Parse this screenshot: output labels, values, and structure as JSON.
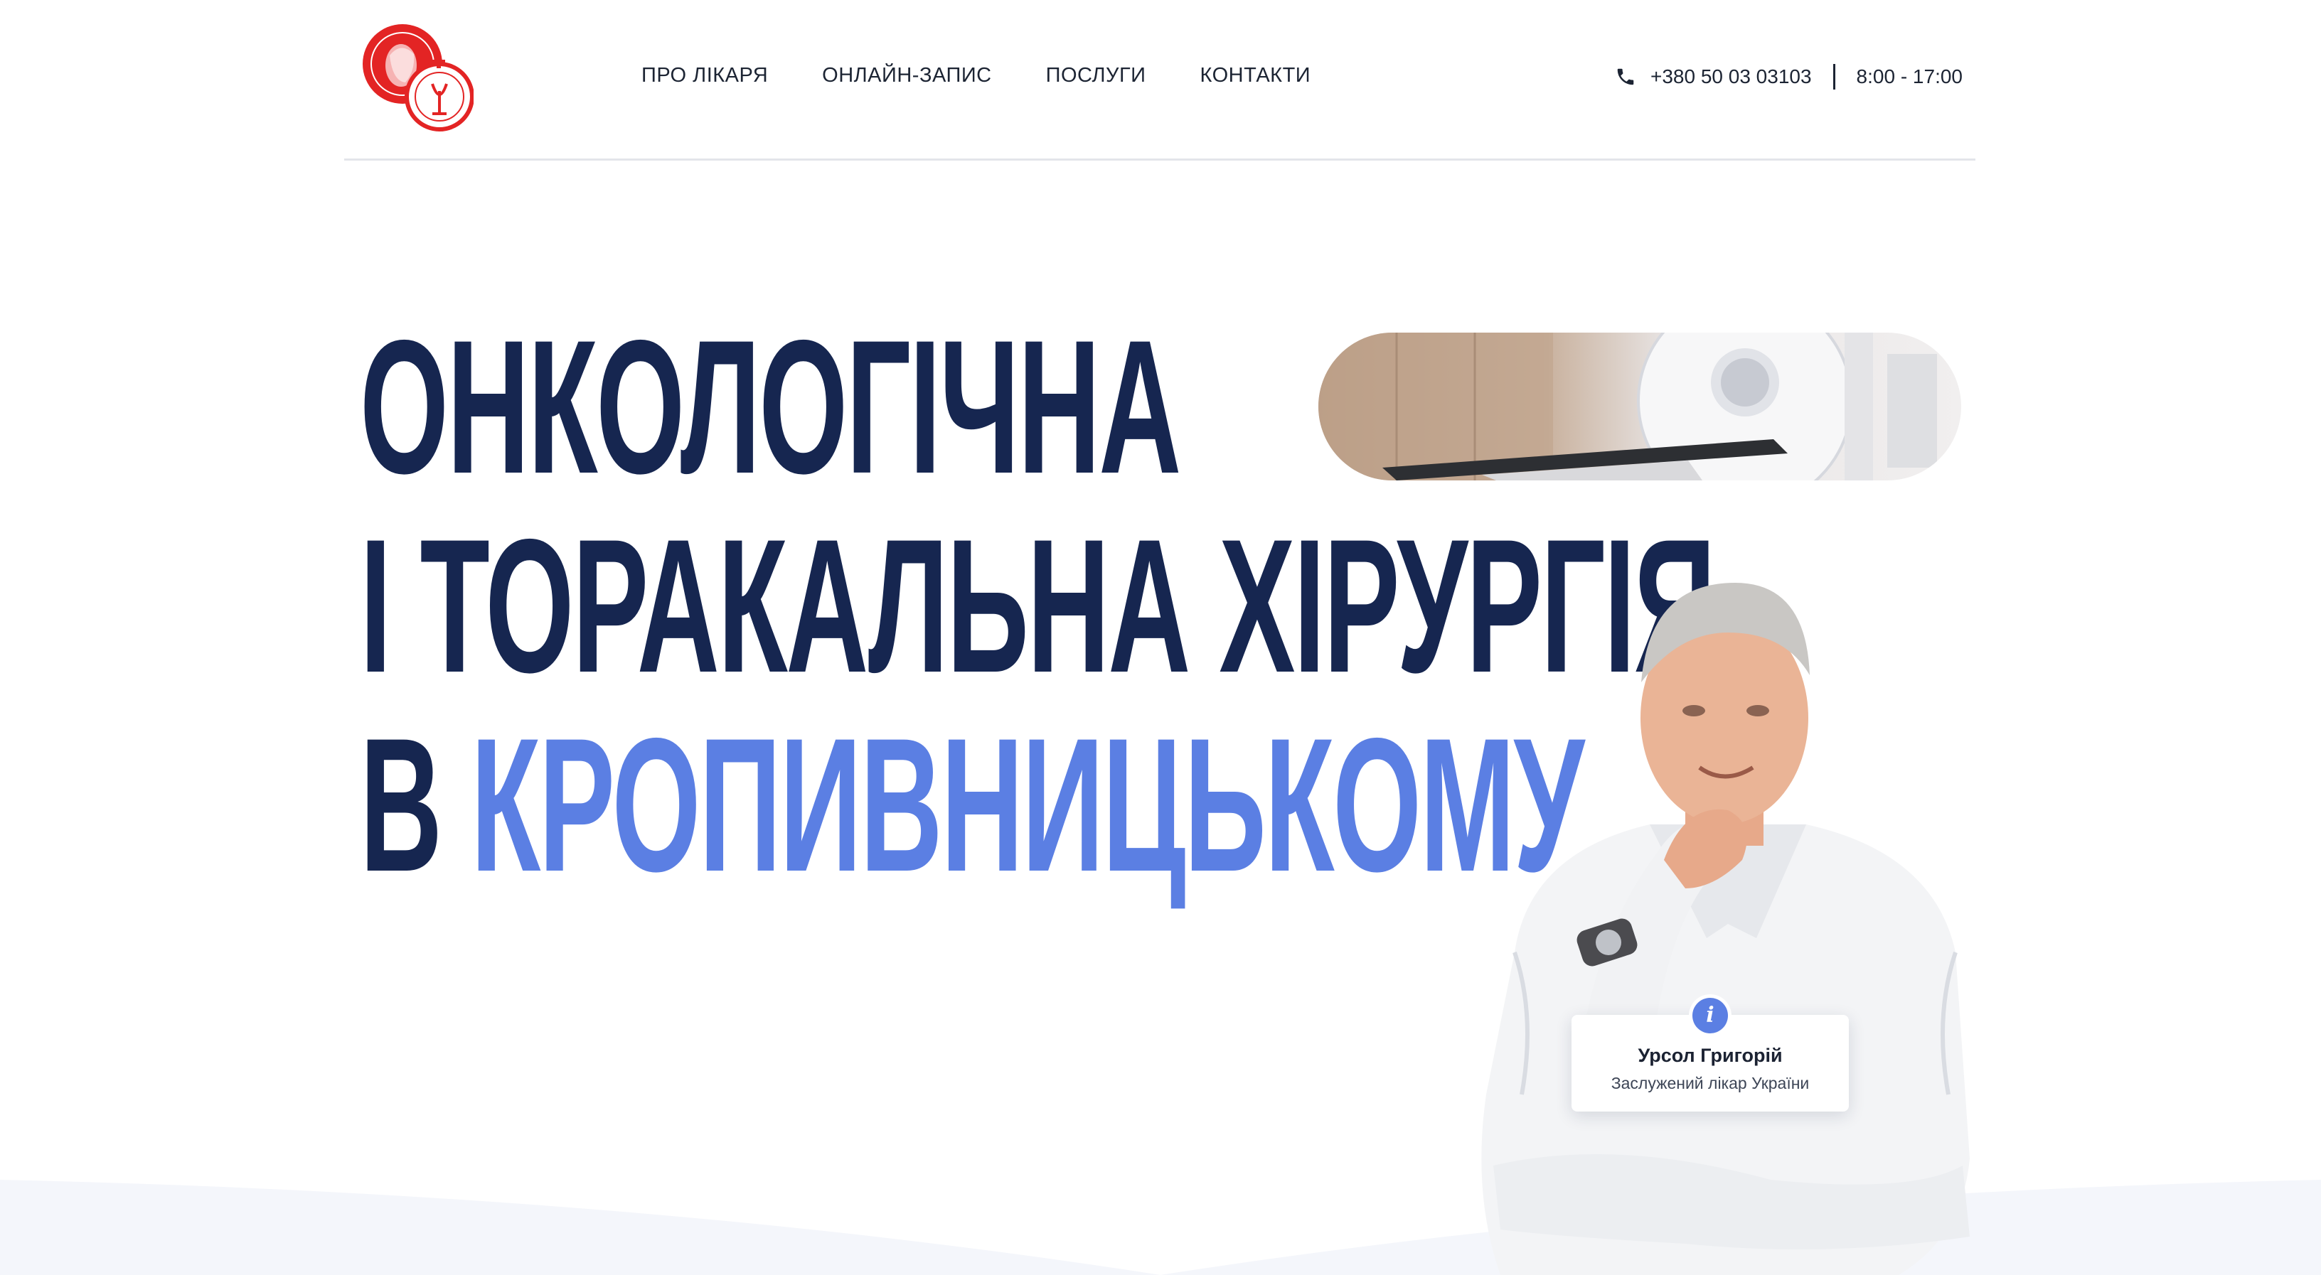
{
  "header": {
    "logo_alt": "Логотип",
    "nav": [
      {
        "label": "ПРО ЛІКАРЯ"
      },
      {
        "label": "ОНЛАЙН-ЗАПИС"
      },
      {
        "label": "ПОСЛУГИ"
      },
      {
        "label": "КОНТАКТИ"
      }
    ],
    "phone": "+380 50 03 03103",
    "hours": "8:00 - 17:00",
    "phone_icon": "phone-icon"
  },
  "hero": {
    "line1": "ОНКОЛОГІЧНА",
    "line2": "І ТОРАКАЛЬНА ХІРУРГІЯ",
    "line3_prefix": "В",
    "line3_accent": "КРОПИВНИЦЬКОМУ"
  },
  "doctor_card": {
    "info_icon": "i",
    "name": "Урсол Григорій",
    "title": "Заслужений лікар України"
  },
  "colors": {
    "heading": "#162650",
    "accent": "#5b7fe3",
    "logo_red": "#e32424"
  }
}
